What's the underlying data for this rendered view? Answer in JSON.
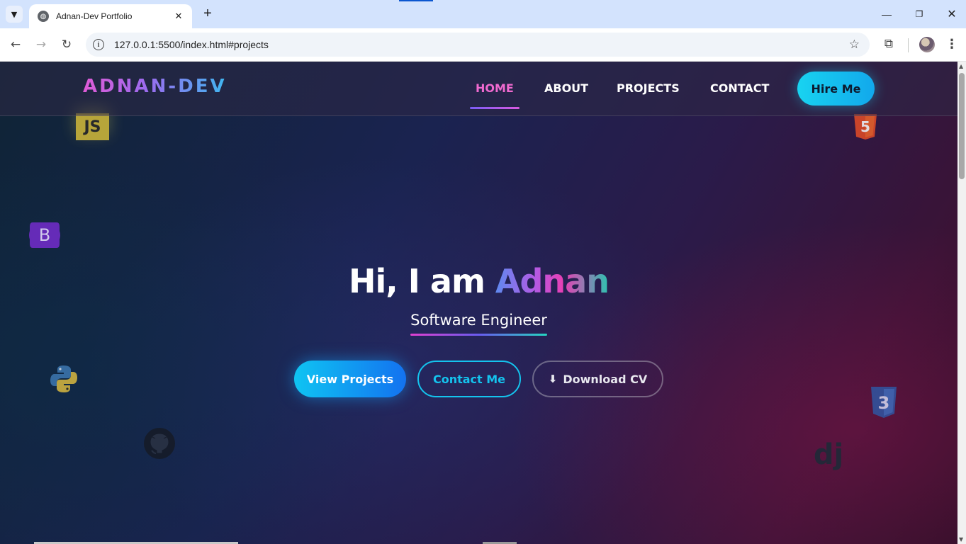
{
  "browser": {
    "tab_title": "Adnan-Dev Portfolio",
    "tab_close": "✕",
    "new_tab": "+",
    "url": "127.0.0.1:5500/index.html#projects",
    "tab_strip_icon": "chevron-down-icon",
    "window_controls": {
      "minimize": "—",
      "maximize": "❐",
      "close": "✕"
    }
  },
  "nav": {
    "logo": "ADNAN-DEV",
    "links": [
      {
        "label": "HOME",
        "active": true
      },
      {
        "label": "ABOUT"
      },
      {
        "label": "PROJECTS"
      },
      {
        "label": "CONTACT"
      }
    ],
    "cta": "Hire Me"
  },
  "hero": {
    "greeting": "Hi, I am ",
    "name": "Adnan",
    "subtitle": "Software Engineer",
    "buttons": {
      "primary": "View Projects",
      "secondary": "Contact Me",
      "download": "Download CV"
    }
  },
  "floating_icons": {
    "js": "JS",
    "bootstrap": "B",
    "django": "dj",
    "html5": "5",
    "css3": "3"
  },
  "colors": {
    "accent_cyan": "#14c4ee",
    "accent_pink": "#f06ad0",
    "accent_purple": "#9b6cf0"
  }
}
